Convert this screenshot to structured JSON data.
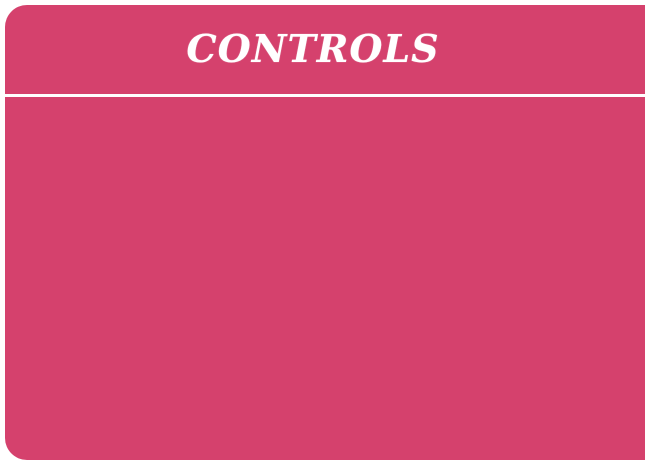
{
  "panel": {
    "title": "CONTROLS",
    "background_color": "#d5416d",
    "text_color": "#ffffff"
  }
}
